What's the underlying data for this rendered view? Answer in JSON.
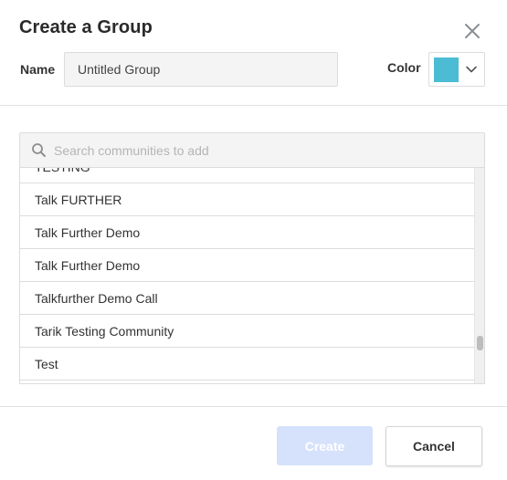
{
  "dialog": {
    "title": "Create a Group",
    "close_icon": "close-icon"
  },
  "name_field": {
    "label": "Name",
    "value": "Untitled Group"
  },
  "color_field": {
    "label": "Color",
    "selected_color": "#4bbcd4",
    "chevron_icon": "chevron-down-icon"
  },
  "search": {
    "placeholder": "Search communities to add",
    "icon": "search-icon"
  },
  "communities": [
    "TESTING",
    "Talk FURTHER",
    "Talk Further Demo",
    "Talk Further Demo",
    "Talkfurther Demo Call",
    "Tarik Testing Community",
    "Test",
    ""
  ],
  "footer": {
    "create_label": "Create",
    "cancel_label": "Cancel"
  },
  "colors": {
    "create_disabled_bg": "#d6e2fb",
    "divider": "#e2e2e2"
  }
}
